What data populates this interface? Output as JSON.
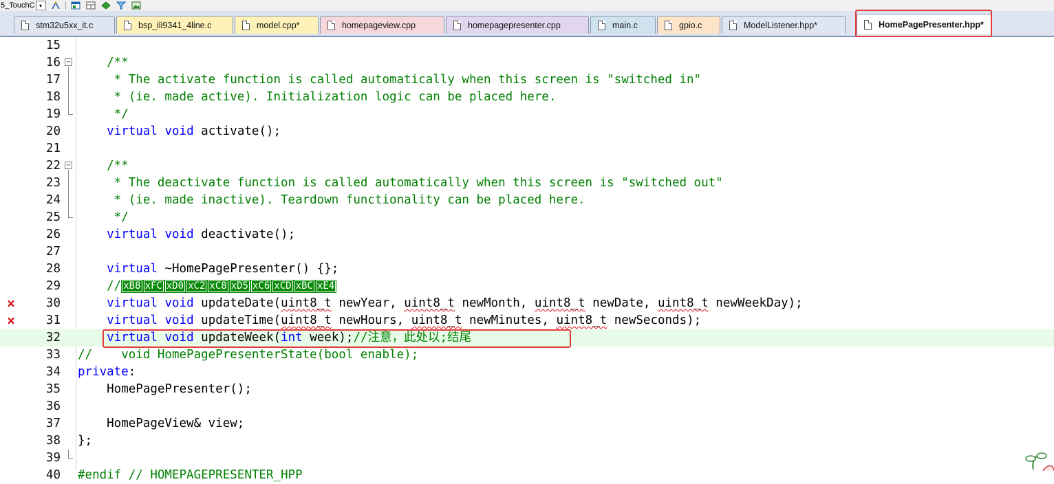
{
  "toolbar": {
    "combo_text": "5_TouchC",
    "icons": [
      "dropdown-arrow-icon",
      "wand-icon",
      "window-icon",
      "layout-icon",
      "diamond-icon",
      "filter-icon",
      "image-icon"
    ]
  },
  "tabs": [
    {
      "label": "stm32u5xx_it.c",
      "color": "#dfe6f2"
    },
    {
      "label": "bsp_ili9341_4line.c",
      "color": "#fff2b8"
    },
    {
      "label": "model.cpp*",
      "color": "#fff2b8"
    },
    {
      "label": "homepageview.cpp",
      "color": "#f6d7dc"
    },
    {
      "label": "homepagepresenter.cpp",
      "color": "#e2d6ee"
    },
    {
      "label": "main.c",
      "color": "#cfe3ee"
    },
    {
      "label": "gpio.c",
      "color": "#fde3c8"
    },
    {
      "label": "ModelListener.hpp*",
      "color": "#dfe6f2"
    },
    {
      "label": "HomePagePresenter.hpp*",
      "color": "#ffffff",
      "active": true
    }
  ],
  "editor": {
    "lines": [
      {
        "n": "15",
        "text": ""
      },
      {
        "n": "16",
        "text": "    /**"
      },
      {
        "n": "17",
        "text": "     * The activate function is called automatically when this screen is \"switched in\""
      },
      {
        "n": "18",
        "text": "     * (ie. made active). Initialization logic can be placed here."
      },
      {
        "n": "19",
        "text": "     */"
      },
      {
        "n": "20",
        "text": "    virtual void activate();"
      },
      {
        "n": "21",
        "text": ""
      },
      {
        "n": "22",
        "text": "    /**"
      },
      {
        "n": "23",
        "text": "     * The deactivate function is called automatically when this screen is \"switched out\""
      },
      {
        "n": "24",
        "text": "     * (ie. made inactive). Teardown functionality can be placed here."
      },
      {
        "n": "25",
        "text": "     */"
      },
      {
        "n": "26",
        "text": "    virtual void deactivate();"
      },
      {
        "n": "27",
        "text": ""
      },
      {
        "n": "28",
        "text": "    virtual ~HomePagePresenter() {};"
      },
      {
        "n": "29",
        "text": "    //xB8xFCxD0xC2xC8xD5xC6xCDxBCxE4",
        "hex_codes": [
          "xB8",
          "xFC",
          "xD0",
          "xC2",
          "xC8",
          "xD5",
          "xC6",
          "xCD",
          "xBC",
          "xE4"
        ]
      },
      {
        "n": "30",
        "text": "    virtual void updateDate(uint8_t newYear, uint8_t newMonth, uint8_t newDate, uint8_t newWeekDay);",
        "error": true
      },
      {
        "n": "31",
        "text": "    virtual void updateTime(uint8_t newHours, uint8_t newMinutes, uint8_t newSeconds);",
        "error": true
      },
      {
        "n": "32",
        "text": "    virtual void updateWeek(int week);//注意，此处以;结尾",
        "current": true
      },
      {
        "n": "33",
        "text": "//    void HomePagePresenterState(bool enable);"
      },
      {
        "n": "34",
        "text": "private:"
      },
      {
        "n": "35",
        "text": "    HomePagePresenter();"
      },
      {
        "n": "36",
        "text": ""
      },
      {
        "n": "37",
        "text": "    HomePageView& view;"
      },
      {
        "n": "38",
        "text": "};"
      },
      {
        "n": "39",
        "text": ""
      },
      {
        "n": "40",
        "text": "#endif // HOMEPAGEPRESENTER_HPP"
      }
    ],
    "error_mark": "×"
  }
}
